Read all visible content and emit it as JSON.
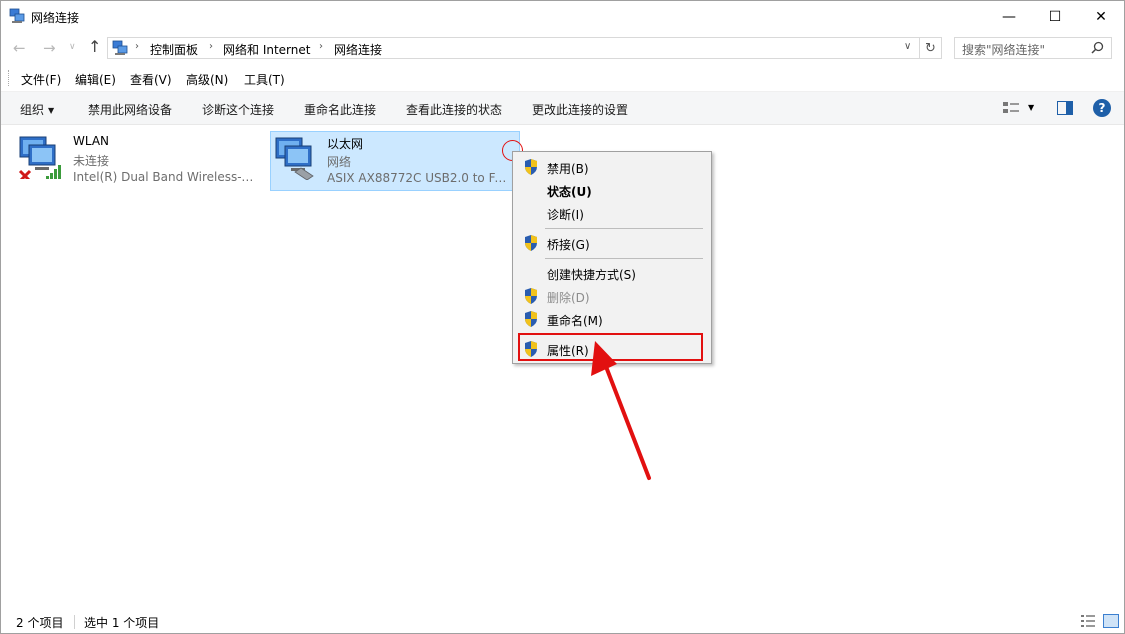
{
  "window": {
    "title": "网络连接",
    "controls": {
      "minimize": "—",
      "maximize": "☐",
      "close": "✕"
    }
  },
  "address": {
    "crumbs": [
      "控制面板",
      "网络和 Internet",
      "网络连接"
    ],
    "search_placeholder": "搜索\"网络连接\""
  },
  "menubar": {
    "items": [
      "文件(F)",
      "编辑(E)",
      "查看(V)",
      "高级(N)",
      "工具(T)"
    ]
  },
  "commandbar": {
    "organize": "组织",
    "items": [
      "禁用此网络设备",
      "诊断这个连接",
      "重命名此连接",
      "查看此连接的状态",
      "更改此连接的设置"
    ],
    "help": "?"
  },
  "connections": [
    {
      "name": "WLAN",
      "status": "未连接",
      "device": "Intel(R) Dual Band Wireless-A..."
    },
    {
      "name": "以太网",
      "status": "网络",
      "device": "ASIX AX88772C USB2.0 to Fast..."
    }
  ],
  "context_menu": {
    "items": [
      {
        "label": "禁用(B)",
        "shield": true,
        "bold": false,
        "disabled": false
      },
      {
        "label": "状态(U)",
        "shield": false,
        "bold": true,
        "disabled": false
      },
      {
        "label": "诊断(I)",
        "shield": false,
        "bold": false,
        "disabled": false
      },
      {
        "label": "桥接(G)",
        "shield": true,
        "bold": false,
        "disabled": false
      },
      {
        "label": "创建快捷方式(S)",
        "shield": false,
        "bold": false,
        "disabled": false
      },
      {
        "label": "删除(D)",
        "shield": true,
        "bold": false,
        "disabled": true
      },
      {
        "label": "重命名(M)",
        "shield": true,
        "bold": false,
        "disabled": false
      },
      {
        "label": "属性(R)",
        "shield": true,
        "bold": false,
        "disabled": false
      }
    ]
  },
  "statusbar": {
    "count": "2 个项目",
    "selected": "选中 1 个项目"
  },
  "colors": {
    "selection_bg": "#cce8ff",
    "annotation_red": "#e21010",
    "accent_blue": "#1e5fa8"
  }
}
